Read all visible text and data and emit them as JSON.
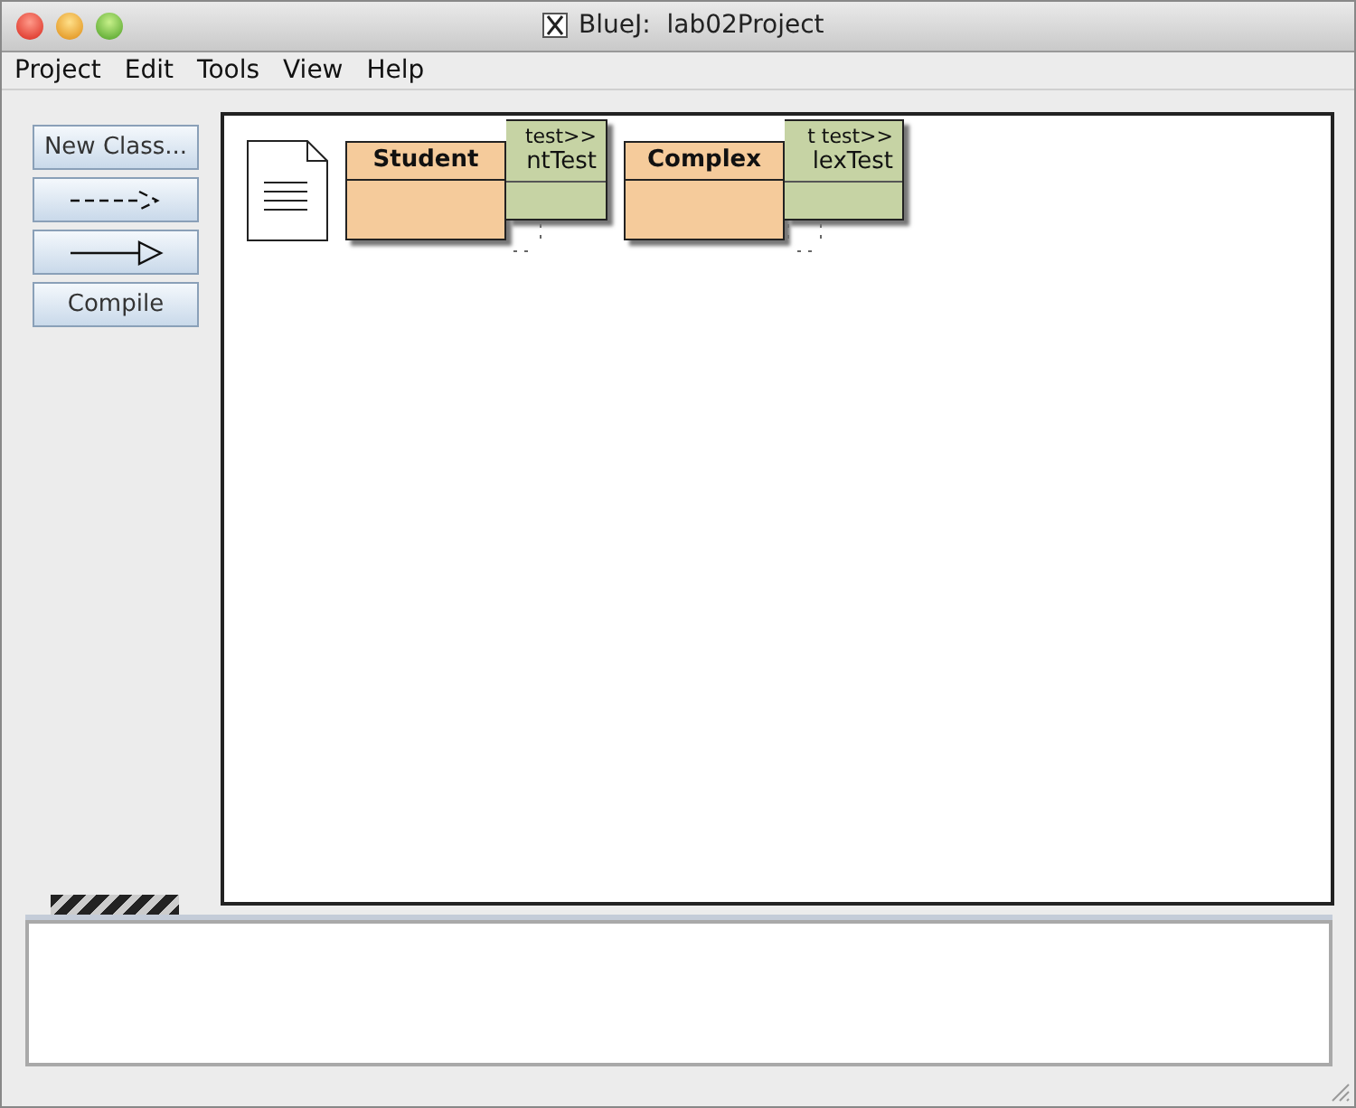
{
  "window": {
    "title": "BlueJ:  lab02Project"
  },
  "menu": [
    "Project",
    "Edit",
    "Tools",
    "View",
    "Help"
  ],
  "tools": [
    {
      "kind": "text",
      "label": "New Class..."
    },
    {
      "kind": "dashed-arrow"
    },
    {
      "kind": "solid-arrow"
    },
    {
      "kind": "text",
      "label": "Compile"
    }
  ],
  "diagram": {
    "classes": [
      {
        "kind": "class",
        "name": "Student"
      },
      {
        "kind": "test",
        "stereotype": "test>>",
        "name": "ntTest"
      },
      {
        "kind": "class",
        "name": "Complex"
      },
      {
        "kind": "test",
        "stereotype": "t test>>",
        "name": "lexTest"
      }
    ]
  }
}
